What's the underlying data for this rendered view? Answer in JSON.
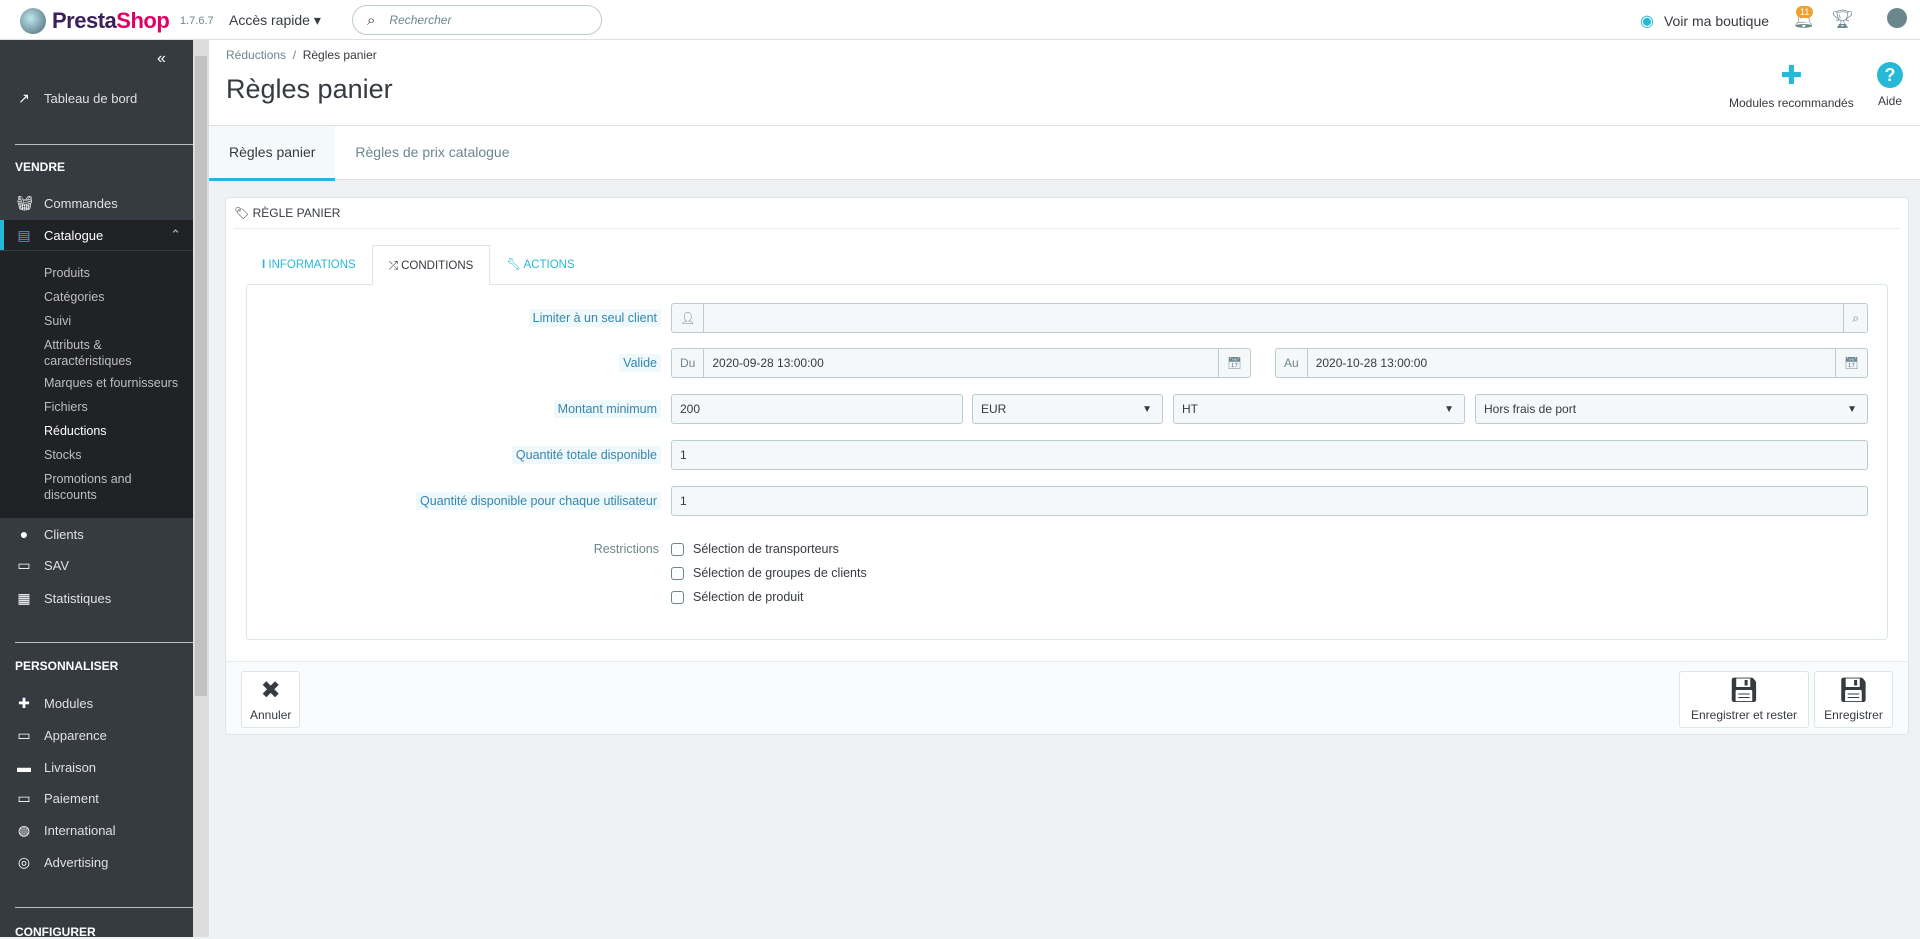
{
  "topbar": {
    "brand": "PrestaShop",
    "version": "1.7.6.7",
    "quick_access": "Accès rapide",
    "search_placeholder": "Rechercher",
    "view_shop": "Voir ma boutique",
    "notifications_count": "11"
  },
  "sidebar": {
    "dashboard": "Tableau de bord",
    "sections": [
      "VENDRE",
      "PERSONNALISER",
      "CONFIGURER"
    ],
    "sell": [
      "Commandes",
      "Catalogue",
      "Clients",
      "SAV",
      "Statistiques"
    ],
    "catalog_sub": [
      "Produits",
      "Catégories",
      "Suivi",
      "Attributs & caractéristiques",
      "Marques et fournisseurs",
      "Fichiers",
      "Réductions",
      "Stocks",
      "Promotions and discounts"
    ],
    "customize": [
      "Modules",
      "Apparence",
      "Livraison",
      "Paiement",
      "International",
      "Advertising"
    ]
  },
  "header": {
    "breadcrumb_parent": "Réductions",
    "breadcrumb_current": "Règles panier",
    "title": "Règles panier",
    "modules_btn": "Modules recommandés",
    "help_btn": "Aide",
    "tabs": [
      "Règles panier",
      "Règles de prix catalogue"
    ]
  },
  "card": {
    "title": "Règle panier",
    "tabs": [
      "Informations",
      "Conditions",
      "Actions"
    ],
    "fields": {
      "customer_label": "Limiter à un seul client",
      "customer_value": "",
      "valid_label": "Valide",
      "from_prefix": "Du",
      "from_value": "2020-09-28 13:00:00",
      "to_prefix": "Au",
      "to_value": "2020-10-28 13:00:00",
      "min_label": "Montant minimum",
      "min_value": "200",
      "currency": "EUR",
      "tax": "HT",
      "shipping": "Hors frais de port",
      "total_qty_label": "Quantité totale disponible",
      "total_qty": "1",
      "user_qty_label": "Quantité disponible pour chaque utilisateur",
      "user_qty": "1",
      "restrictions_label": "Restrictions",
      "restrictions": [
        "Sélection de transporteurs",
        "Sélection de groupes de clients",
        "Sélection de produit"
      ]
    },
    "buttons": {
      "cancel": "Annuler",
      "save_stay": "Enregistrer et rester",
      "save": "Enregistrer"
    }
  },
  "colors": {
    "accent": "#25b9d7",
    "sidebar": "#363a41",
    "brand_pink": "#df0067"
  }
}
